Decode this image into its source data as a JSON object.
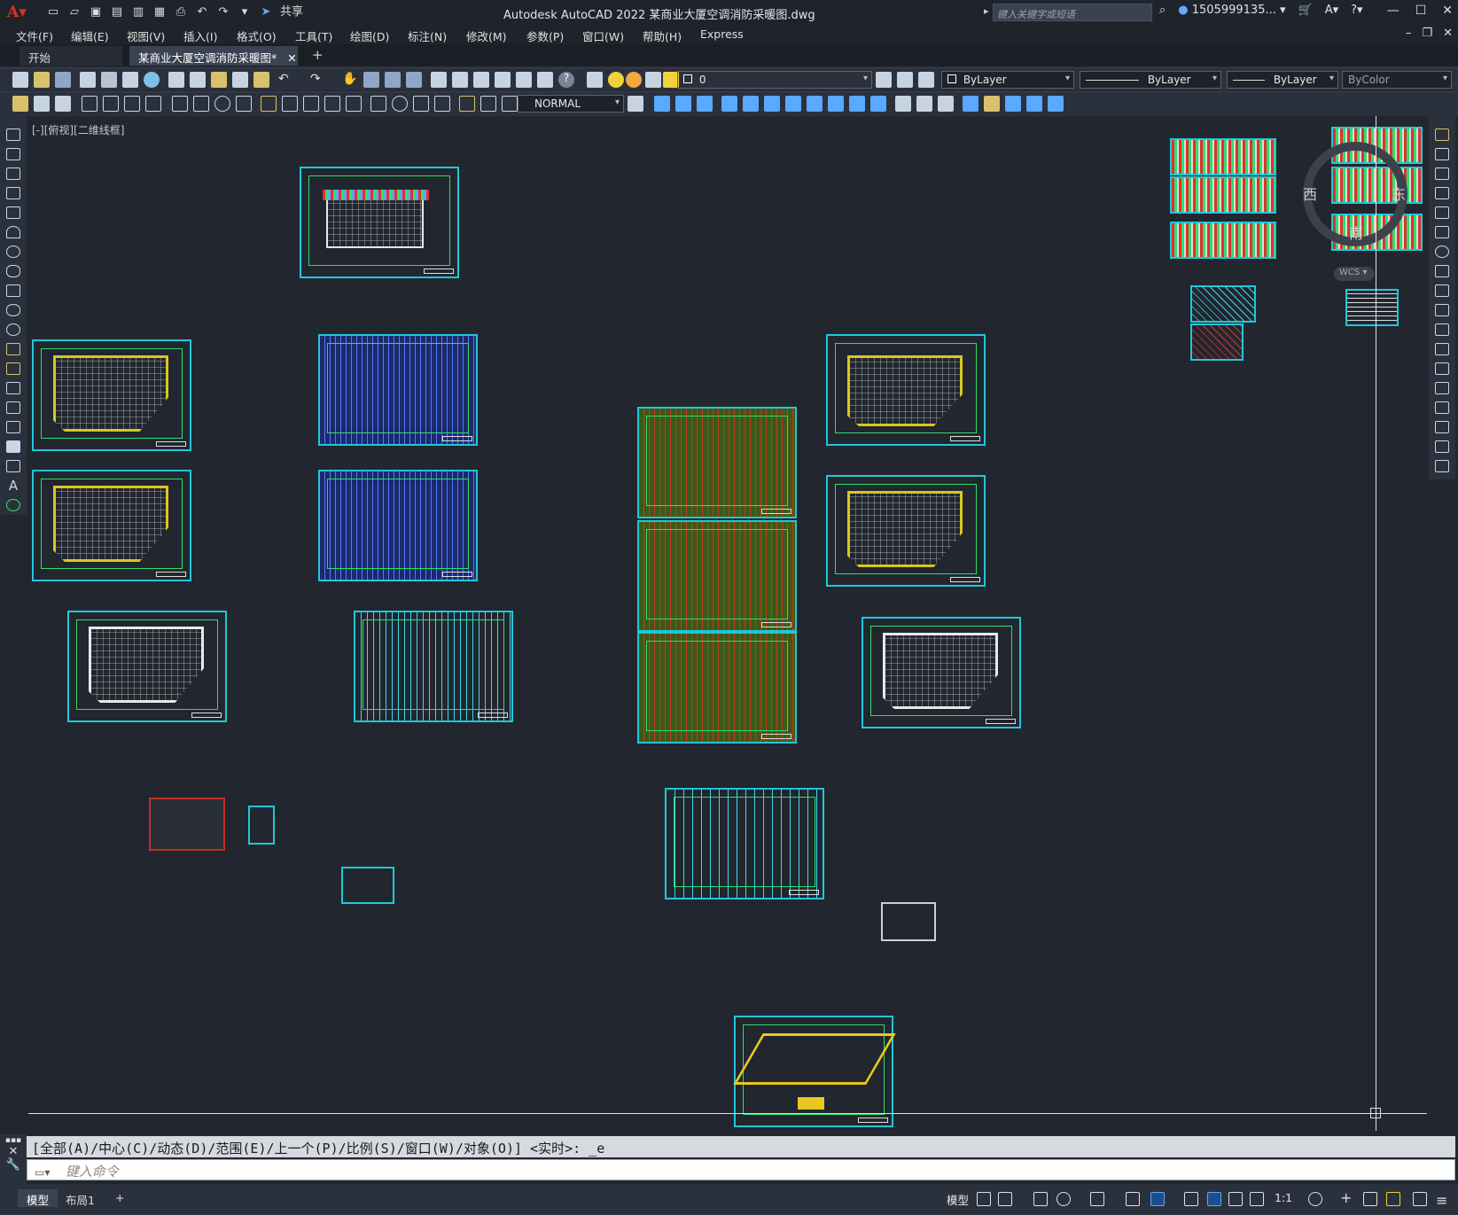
{
  "app": {
    "title": "Autodesk AutoCAD 2022    某商业大厦空调消防采暖图.dwg",
    "share_label": "共享",
    "search_placeholder": "键入关键字或短语",
    "user": "1505999135..."
  },
  "menu": [
    "文件(F)",
    "编辑(E)",
    "视图(V)",
    "插入(I)",
    "格式(O)",
    "工具(T)",
    "绘图(D)",
    "标注(N)",
    "修改(M)",
    "参数(P)",
    "窗口(W)",
    "帮助(H)",
    "Express"
  ],
  "tabs": {
    "start": "开始",
    "active": "某商业大厦空调消防采暖图*",
    "plus": "+"
  },
  "toolbar": {
    "layer_value": "0",
    "color_value": "ByLayer",
    "linetype_value": "ByLayer",
    "lineweight_value": "ByLayer",
    "plotstyle_value": "ByColor",
    "dimstyle_value": "NORMAL"
  },
  "viewport": {
    "label": "[-][俯视][二维线框]",
    "compass": {
      "west": "西",
      "east": "东",
      "south": "南"
    },
    "wcs": "WCS"
  },
  "command": {
    "history": "[全部(A)/中心(C)/动态(D)/范围(E)/上一个(P)/比例(S)/窗口(W)/对象(O)] <实时>: _e",
    "placeholder": "键入命令"
  },
  "status": {
    "layout_tabs": [
      "模型",
      "布局1"
    ],
    "plus": "+",
    "model_label": "模型",
    "scale": "1:1"
  },
  "colors": {
    "accent": "#1fc8d8",
    "background": "#21262f",
    "frame": "#2ee06a"
  }
}
